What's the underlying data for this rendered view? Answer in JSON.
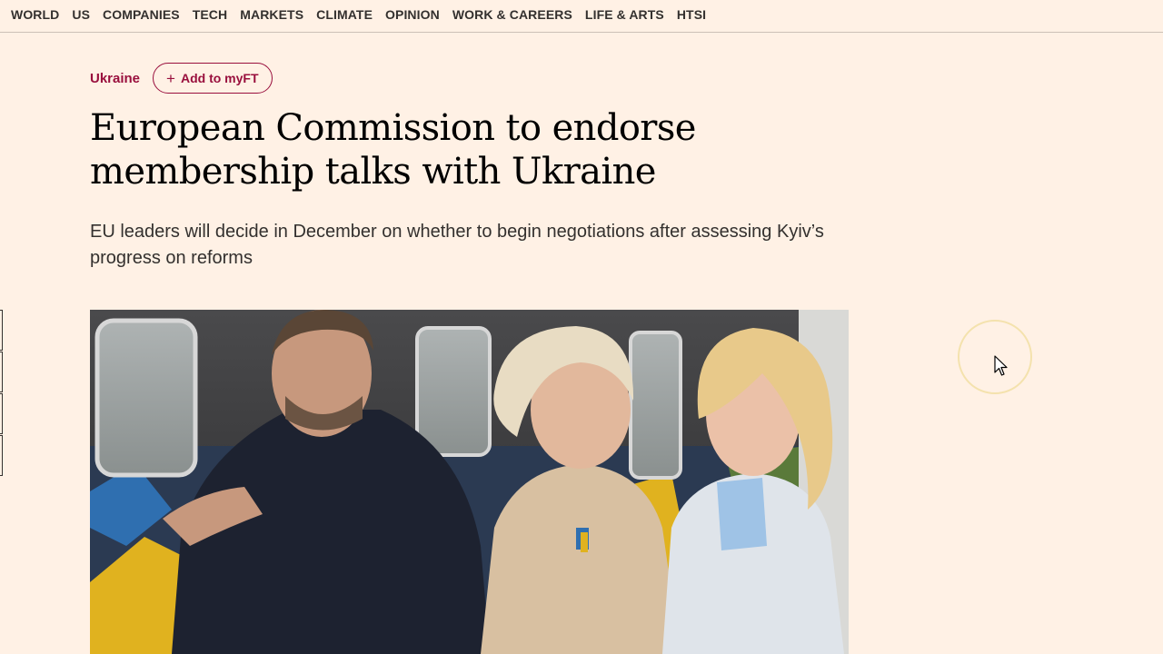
{
  "nav": {
    "items": [
      "WORLD",
      "US",
      "COMPANIES",
      "TECH",
      "MARKETS",
      "CLIMATE",
      "OPINION",
      "WORK & CAREERS",
      "LIFE & ARTS",
      "HTSI"
    ]
  },
  "article": {
    "topic": "Ukraine",
    "add_to_myft": "Add to myFT",
    "headline": "European Commission to endorse membership talks with Ukraine",
    "standfirst": "EU leaders will decide in December on whether to begin negotiations after assessing Kyiv’s progress on reforms"
  },
  "colors": {
    "background": "#fff1e5",
    "accent": "#990f3d",
    "text": "#33302e"
  },
  "icons": {
    "plus": "plus-icon",
    "cursor": "mouse-pointer-icon"
  }
}
